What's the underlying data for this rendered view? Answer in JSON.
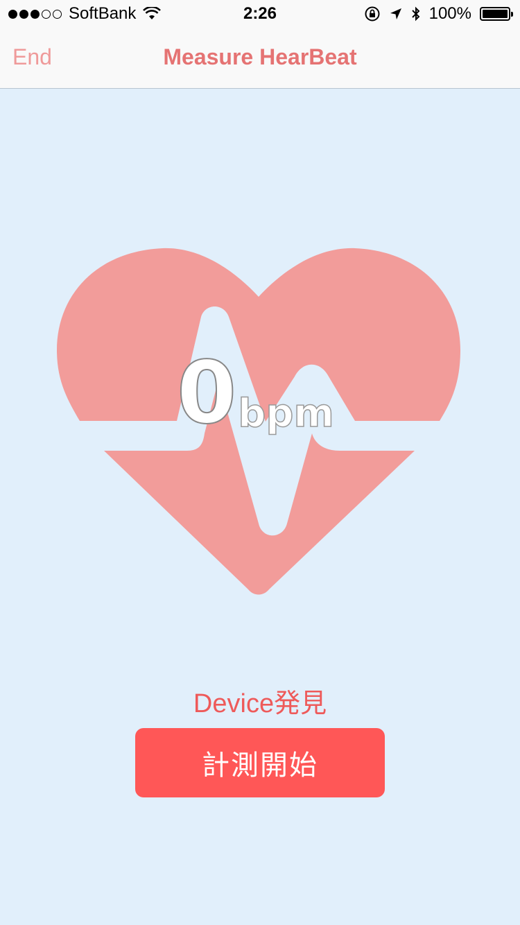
{
  "status_bar": {
    "carrier": "SoftBank",
    "time": "2:26",
    "battery": "100%",
    "signal_bars_filled": 3,
    "signal_bars_total": 5,
    "icons": [
      "wifi-icon",
      "orientation-lock-icon",
      "location-arrow-icon",
      "bluetooth-icon",
      "battery-icon"
    ]
  },
  "nav": {
    "back_label": "End",
    "title": "Measure HearBeat"
  },
  "heart_rate": {
    "value": "0",
    "unit": "bpm"
  },
  "device": {
    "status": "Device発見"
  },
  "actions": {
    "start_label": "計測開始"
  },
  "colors": {
    "background": "#e1effb",
    "heart": "#f29c9a",
    "accent": "#ff5757",
    "title": "#e57373"
  }
}
